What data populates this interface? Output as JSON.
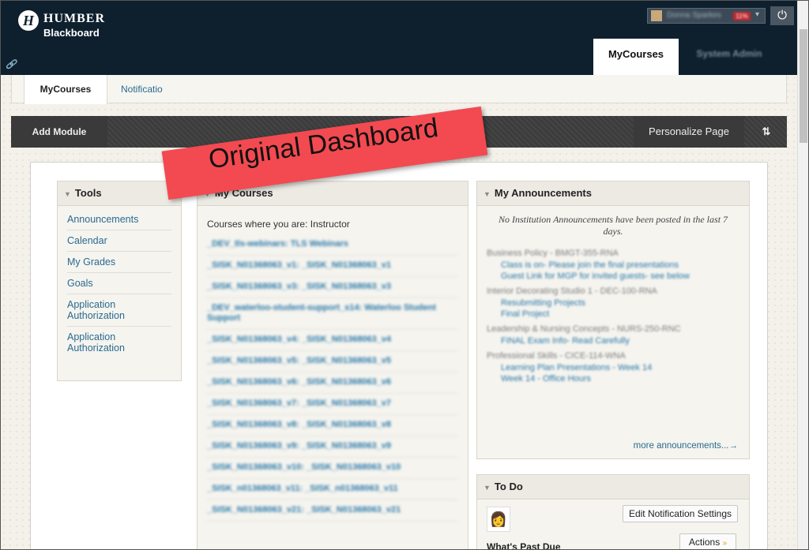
{
  "header": {
    "logo_line1": "HUMBER",
    "logo_line2": "Blackboard",
    "logo_mark": "H",
    "user_name": "Donna Sparkes",
    "user_badge": "11%",
    "tabs": [
      {
        "label": "MyCourses",
        "active": true
      },
      {
        "label": "System Admin",
        "active": false
      }
    ]
  },
  "subnav": {
    "tabs": [
      {
        "label": "MyCourses",
        "active": true
      },
      {
        "label": "Notificatio",
        "active": false
      }
    ]
  },
  "overlay_banner": "Original Dashboard",
  "module_bar": {
    "add_module": "Add Module",
    "personalize": "Personalize Page",
    "reorder": "⇅"
  },
  "tools": {
    "title": "Tools",
    "items": [
      "Announcements",
      "Calendar",
      "My Grades",
      "Goals",
      "Application Authorization",
      "Application Authorization"
    ]
  },
  "courses": {
    "title": "My Courses",
    "subtitle": "Courses where you are: Instructor",
    "items": [
      "_DEV_tls-webinars: TLS Webinars",
      "_SISK_N01368063_v1: _SISK_N01368063_v1",
      "_SISK_N01368063_v3: _SISK_N01368063_v3",
      "_DEV_waterloo-student-support_s14: Waterloo Student Support",
      "_SISK_N01368063_v4: _SISK_N01368063_v4",
      "_SISK_N01368063_v5: _SISK_N01368063_v5",
      "_SISK_N01368063_v6: _SISK_N01368063_v6",
      "_SISK_N01368063_v7: _SISK_N01368063_v7",
      "_SISK_N01368063_v8: _SISK_N01368063_v8",
      "_SISK_N01368063_v9: _SISK_N01368063_v9",
      "_SISK_N01368063_v10: _SISK_N01368063_v10",
      "_SISK_n01368063_v11: _SISK_n01368063_v11",
      "_SISK_N01368063_v21: _SISK_N01368063_v21"
    ]
  },
  "announcements": {
    "title": "My Announcements",
    "note": "No Institution Announcements have been posted in the last 7 days.",
    "groups": [
      {
        "course": "Business Policy - BMGT-355-RNA",
        "items": [
          "Class is on- Please join the final presentations",
          "Guest Link for MGP for invited guests- see below"
        ]
      },
      {
        "course": "Interior Decorating Studio 1 - DEC-100-RNA",
        "items": [
          "Resubmitting Projects",
          "Final Project"
        ]
      },
      {
        "course": "Leadership & Nursing Concepts - NURS-250-RNC",
        "items": [
          "FINAL Exam Info- Read Carefully"
        ]
      },
      {
        "course": "Professional Skills - CICE-114-WNA",
        "items": [
          "Learning Plan Presentations - Week 14",
          "Week 14 - Office Hours"
        ]
      }
    ],
    "more": "more announcements...→"
  },
  "todo": {
    "title": "To Do",
    "edit_button": "Edit Notification Settings",
    "actions_button": "Actions",
    "past_due": "What's Past Due"
  }
}
